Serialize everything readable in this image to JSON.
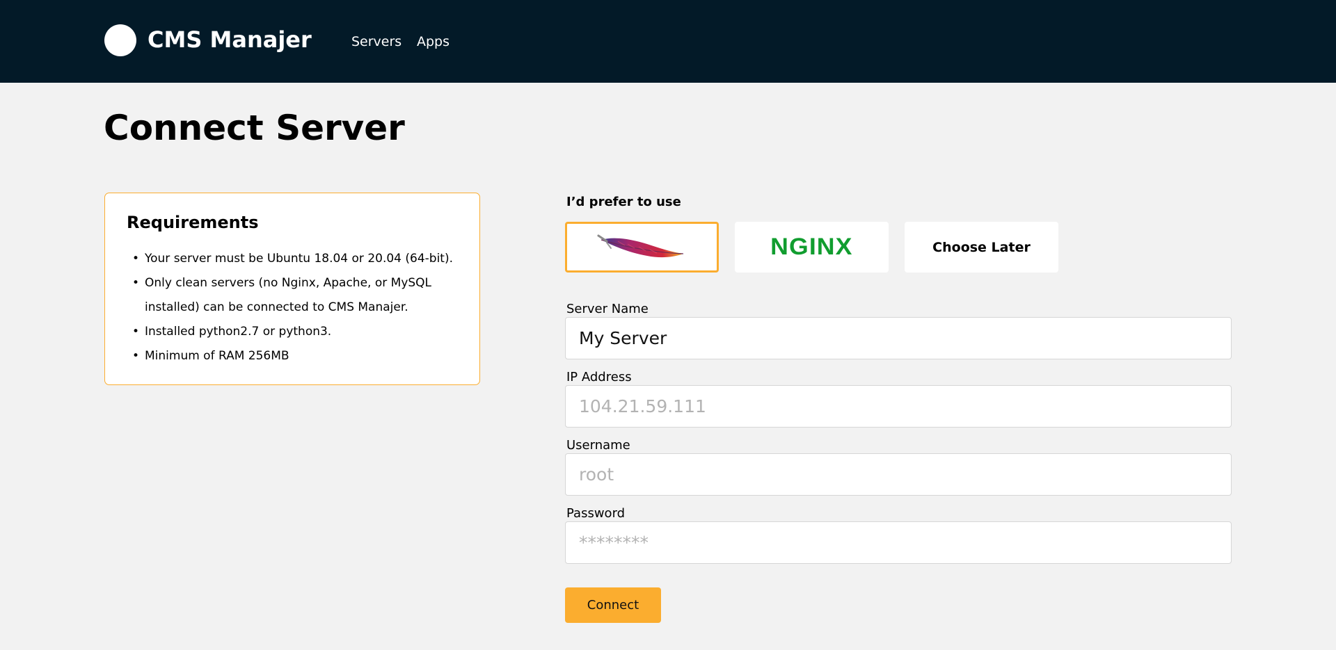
{
  "header": {
    "brand": "CMS Manajer",
    "nav": [
      {
        "label": "Servers"
      },
      {
        "label": "Apps"
      }
    ]
  },
  "page": {
    "title": "Connect Server"
  },
  "requirements": {
    "title": "Requirements",
    "items": [
      "Your server must be Ubuntu 18.04 or 20.04 (64-bit).",
      "Only clean servers (no Nginx, Apache, or MySQL installed) can be connected to CMS Manajer.",
      "Installed python2.7 or python3.",
      "Minimum of RAM 256MB"
    ]
  },
  "server_type": {
    "label": "I’d prefer to use",
    "options": [
      {
        "icon": "apache-feather-logo",
        "selected": true
      },
      {
        "logo_text": "NGINX",
        "icon": "nginx-logo",
        "selected": false
      },
      {
        "label": "Choose Later",
        "selected": false
      }
    ],
    "accent_color": "#fbad2f"
  },
  "form": {
    "server_name": {
      "label": "Server Name",
      "value": "My Server",
      "placeholder": ""
    },
    "ip_address": {
      "label": "IP Address",
      "value": "",
      "placeholder": "104.21.59.111"
    },
    "username": {
      "label": "Username",
      "value": "",
      "placeholder": "root"
    },
    "password": {
      "label": "Password",
      "value": "",
      "placeholder": "********"
    },
    "submit_label": "Connect"
  },
  "colors": {
    "header_bg": "#031a28",
    "page_bg": "#f2f2f2",
    "accent": "#fbad2f",
    "nginx_green": "#119d2f"
  }
}
